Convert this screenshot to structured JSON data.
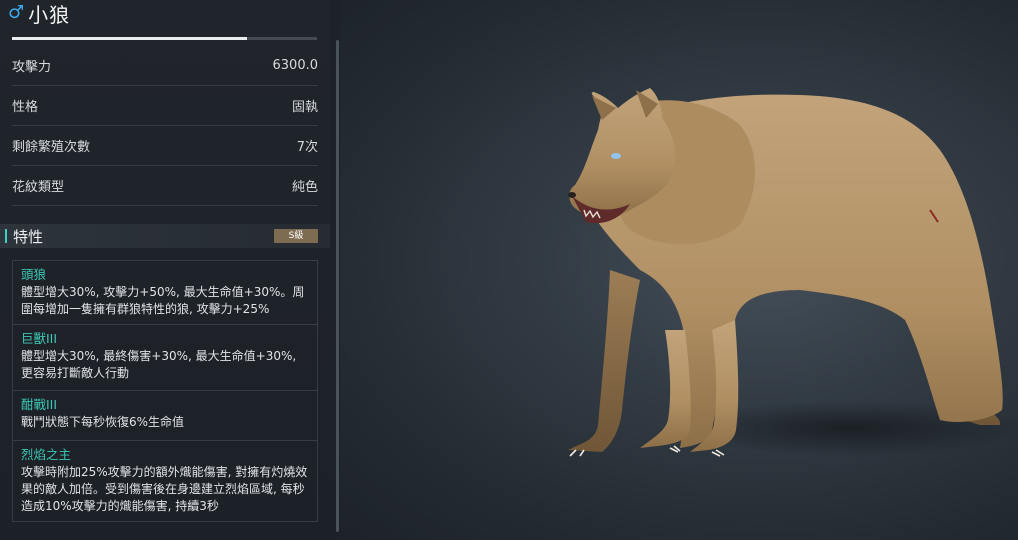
{
  "pet": {
    "gender_symbol": "♂",
    "name": "小狼",
    "experience_progress": 0.77
  },
  "stats": [
    {
      "label": "攻擊力",
      "value": "6300.0"
    },
    {
      "label": "性格",
      "value": "固執"
    },
    {
      "label": "剩餘繁殖次數",
      "value": "7次"
    },
    {
      "label": "花紋類型",
      "value": "純色"
    }
  ],
  "traits_section": {
    "title": "特性",
    "grade": "S級"
  },
  "traits": [
    {
      "name": "頭狼",
      "desc": "體型增大30%, 攻擊力+50%, 最大生命值+30%。周圍每增加一隻擁有群狼特性的狼, 攻擊力+25%"
    },
    {
      "name": "巨獸III",
      "desc": "體型增大30%, 最終傷害+30%, 最大生命值+30%, 更容易打斷敵人行動"
    },
    {
      "name": "酣戰III",
      "desc": "戰鬥狀態下每秒恢復6%生命值"
    },
    {
      "name": "烈焰之主",
      "desc": "攻擊時附加25%攻擊力的額外熾能傷害, 對擁有灼燒效果的敵人加倍。受到傷害後在身邊建立烈焰區域, 每秒造成10%攻擊力的熾能傷害, 持續3秒"
    }
  ],
  "colors": {
    "accent": "#3cc8b4",
    "gender": "#3fa9ee",
    "grade_badge": "#7e6c52"
  }
}
